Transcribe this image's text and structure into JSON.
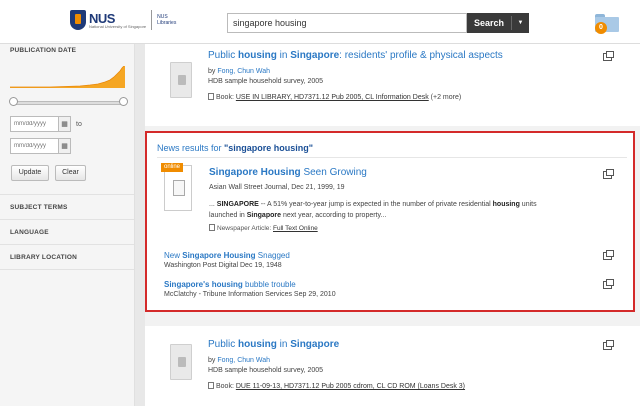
{
  "header": {
    "logo_nus": "NUS",
    "logo_sub": "National University of Singapore",
    "logo_libraries": [
      "NUS",
      "Libraries"
    ],
    "search_value": "singapore housing",
    "search_button": "Search",
    "folder_count": "0"
  },
  "sidebar": {
    "publication_date": "PUBLICATION DATE",
    "date_placeholder": "mm/dd/yyyy",
    "to_label": "to",
    "update_button": "Update",
    "clear_button": "Clear",
    "subject_terms": "SUBJECT TERMS",
    "language": "LANGUAGE",
    "library_location": "LIBRARY LOCATION"
  },
  "results": [
    {
      "title_parts": [
        "Public ",
        "housing",
        " in ",
        "Singapore",
        ": residents' profile & physical aspects"
      ],
      "author_prefix": "by ",
      "author": "Fong, Chun Wah",
      "note": "HDB sample household survey, 2005",
      "availability_prefix": "Book: ",
      "availability": "USE IN LIBRARY, HD7371.12 Pub 2005, CL Information Desk",
      "availability_more": " (+2 more)"
    },
    {
      "title_parts": [
        "Public ",
        "housing",
        " in ",
        "Singapore"
      ],
      "author_prefix": "by ",
      "author": "Fong, Chun Wah",
      "note": "HDB sample household survey, 2005",
      "availability_prefix": "Book: ",
      "availability": "DUE 11-09-13, HD7371.12 Pub 2005 cdrom, CL CD ROM (Loans Desk 3)"
    }
  ],
  "news": {
    "heading_prefix": "News results for ",
    "heading_query": "\"singapore housing\"",
    "online_badge": "online",
    "main": {
      "title_bold": "Singapore Housing",
      "title_rest": " Seen Growing",
      "meta": "Asian Wall Street Journal, Dec 21, 1999, 19",
      "snippet_1": "... ",
      "snippet_b1": "SINGAPORE",
      "snippet_2": " -- A 51% year-to-year jump is expected in the number of private residential ",
      "snippet_b2": "housing",
      "snippet_3": " units launched in ",
      "snippet_b3": "Singapore",
      "snippet_4": " next year, according to property...",
      "type_label": "Newspaper Article: ",
      "type_link": "Full Text Online"
    },
    "item2": {
      "title_pre": "New ",
      "title_bold": "Singapore Housing",
      "title_rest": " Snagged",
      "meta": "Washington Post Digital  Dec 19, 1948"
    },
    "item3": {
      "title_bold": "Singapore's housing",
      "title_rest": " bubble trouble",
      "meta": "McClatchy - Tribune Information Services   Sep 29, 2010"
    }
  },
  "colors": {
    "link": "#2a78c4",
    "highlight_border": "#d42a2a",
    "accent": "#f08c00"
  }
}
